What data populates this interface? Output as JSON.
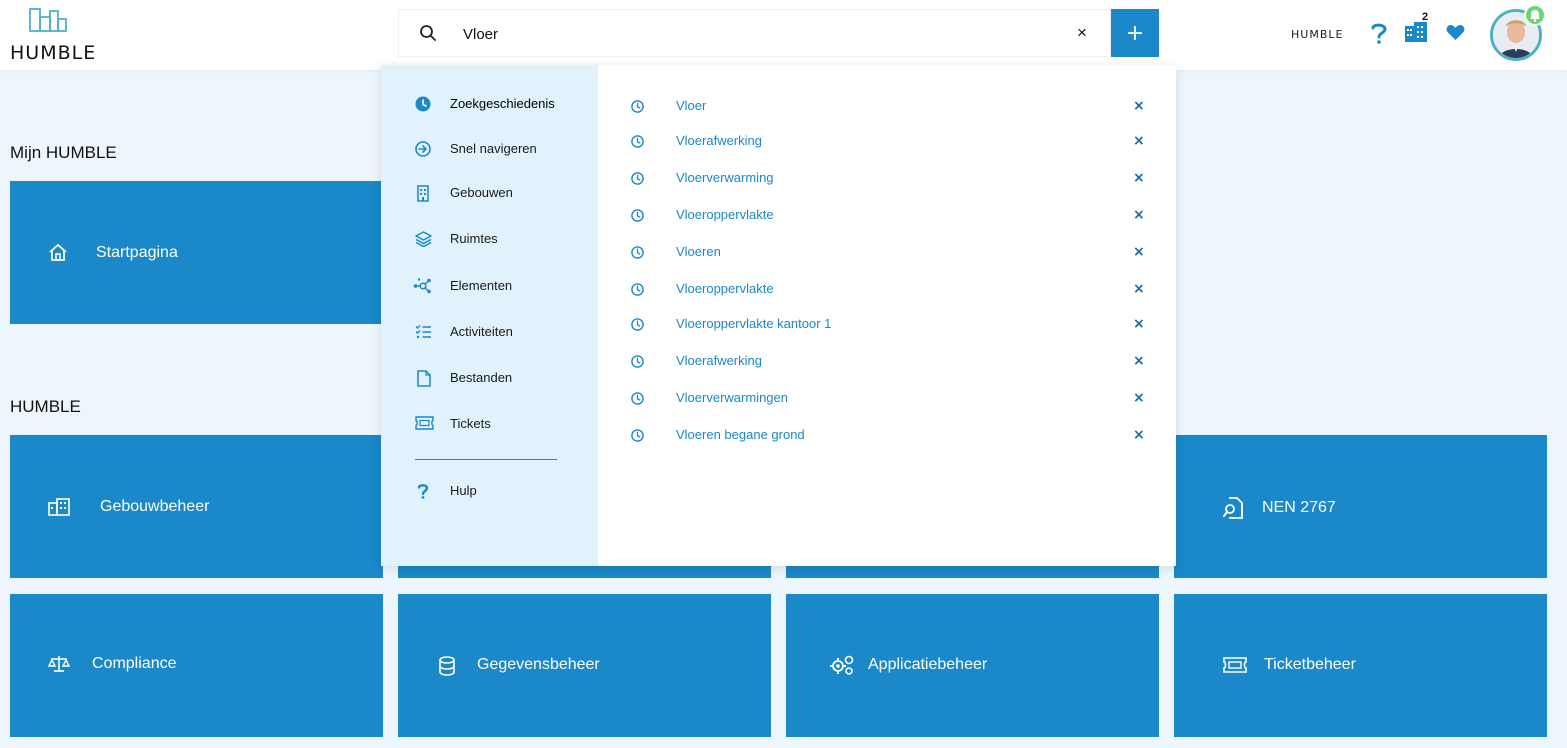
{
  "header": {
    "logo_text": "HUMBLE",
    "search": {
      "value": "Vloer",
      "placeholder": ""
    },
    "clear_symbol": "×",
    "add_symbol": "+",
    "org_label": "HUMBLE",
    "buildings_badge": "2",
    "icons": [
      "help-icon",
      "buildings-icon",
      "heart-icon",
      "avatar",
      "notification-bell-icon"
    ]
  },
  "sections": {
    "mine": {
      "title": "Mijn HUMBLE",
      "tiles": [
        {
          "label": "Startpagina",
          "icon": "home-icon"
        }
      ]
    },
    "humble": {
      "title": "HUMBLE",
      "tiles": [
        {
          "label": "Gebouwbeheer",
          "icon": "buildings-icon"
        },
        {
          "label": "NEN 2767",
          "icon": "inspection-document-icon"
        },
        {
          "label": "Compliance",
          "icon": "scales-icon"
        },
        {
          "label": "Gegevensbeheer",
          "icon": "database-icon"
        },
        {
          "label": "Applicatiebeheer",
          "icon": "gears-icon"
        },
        {
          "label": "Ticketbeheer",
          "icon": "ticket-icon"
        }
      ]
    }
  },
  "dropdown": {
    "categories": [
      {
        "label": "Zoekgeschiedenis",
        "icon": "clock-icon",
        "active": true
      },
      {
        "label": "Snel navigeren",
        "icon": "arrow-circle-icon"
      },
      {
        "label": "Gebouwen",
        "icon": "building-icon"
      },
      {
        "label": "Ruimtes",
        "icon": "layers-icon"
      },
      {
        "label": "Elementen",
        "icon": "nodes-icon"
      },
      {
        "label": "Activiteiten",
        "icon": "checklist-icon"
      },
      {
        "label": "Bestanden",
        "icon": "file-icon"
      },
      {
        "label": "Tickets",
        "icon": "ticket-icon"
      }
    ],
    "help": {
      "label": "Hulp",
      "icon": "question-icon"
    },
    "history": [
      "Vloer",
      "Vloerafwerking",
      "Vloerverwarming",
      "Vloeroppervlakte",
      "Vloeren",
      "Vloeroppervlakte",
      "Vloeroppervlakte kantoor 1",
      "Vloerafwerking",
      "Vloerverwarmingen",
      "Vloeren begane grond"
    ],
    "remove_symbol": "×"
  },
  "colors": {
    "primary": "#1a88c9",
    "background": "#eef6fd",
    "sidebar": "#e2f2fc",
    "notification": "#6bd475"
  }
}
